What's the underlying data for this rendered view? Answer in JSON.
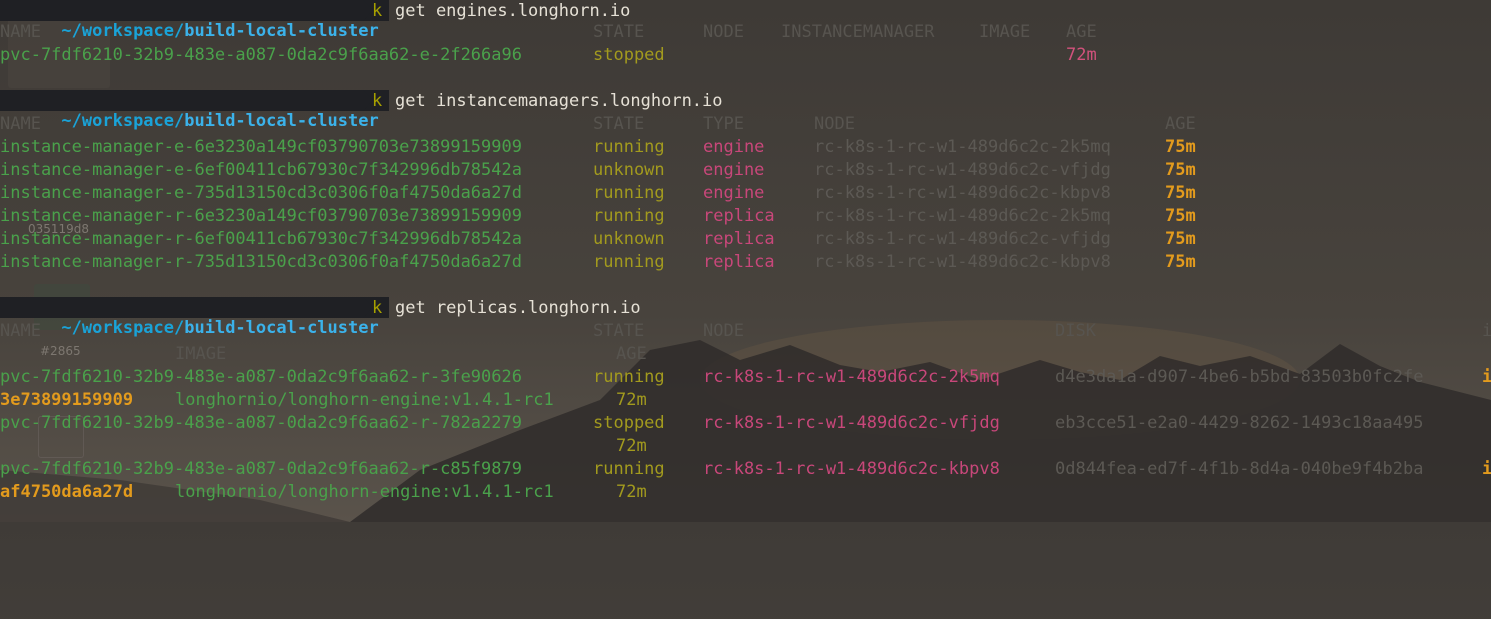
{
  "prompt": {
    "path_prefix": "~/workspace/",
    "path_dir": "build-local-cluster",
    "alias": "k"
  },
  "blocks": [
    {
      "command": "get engines.longhorn.io",
      "headers": [
        "NAME",
        "STATE",
        "NODE",
        "INSTANCEMANAGER",
        "IMAGE",
        "AGE"
      ],
      "rows": [
        {
          "name": "pvc-7fdf6210-32b9-483e-a087-0da2c9f6aa62-e-2f266a96",
          "state": "stopped",
          "age": "72m"
        }
      ]
    },
    {
      "command": "get instancemanagers.longhorn.io",
      "headers": [
        "NAME",
        "STATE",
        "TYPE",
        "NODE",
        "AGE"
      ],
      "rows": [
        {
          "name": "instance-manager-e-6e3230a149cf03790703e73899159909",
          "state": "running",
          "type": "engine",
          "node": "rc-k8s-1-rc-w1-489d6c2c-2k5mq",
          "age": "75m"
        },
        {
          "name": "instance-manager-e-6ef00411cb67930c7f342996db78542a",
          "state": "unknown",
          "type": "engine",
          "node": "rc-k8s-1-rc-w1-489d6c2c-vfjdg",
          "age": "75m"
        },
        {
          "name": "instance-manager-e-735d13150cd3c0306f0af4750da6a27d",
          "state": "running",
          "type": "engine",
          "node": "rc-k8s-1-rc-w1-489d6c2c-kbpv8",
          "age": "75m"
        },
        {
          "name": "instance-manager-r-6e3230a149cf03790703e73899159909",
          "state": "running",
          "type": "replica",
          "node": "rc-k8s-1-rc-w1-489d6c2c-2k5mq",
          "age": "75m"
        },
        {
          "name": "instance-manager-r-6ef00411cb67930c7f342996db78542a",
          "state": "unknown",
          "type": "replica",
          "node": "rc-k8s-1-rc-w1-489d6c2c-vfjdg",
          "age": "75m"
        },
        {
          "name": "instance-manager-r-735d13150cd3c0306f0af4750da6a27d",
          "state": "running",
          "type": "replica",
          "node": "rc-k8s-1-rc-w1-489d6c2c-kbpv8",
          "age": "75m"
        }
      ]
    },
    {
      "command": "get replicas.longhorn.io",
      "headers": [
        "NAME",
        "STATE",
        "NODE",
        "DISK",
        "i"
      ],
      "headers_wrap": [
        "IMAGE",
        "AGE"
      ],
      "rows": [
        {
          "name": "pvc-7fdf6210-32b9-483e-a087-0da2c9f6aa62-r-3fe90626",
          "state": "running",
          "node": "rc-k8s-1-rc-w1-489d6c2c-2k5mq",
          "disk": "d4e3da1a-d907-4be6-b5bd-83503b0fc2fe",
          "trail": "i",
          "wrap_im": "3e73899159909",
          "wrap_image": "longhornio/longhorn-engine:v1.4.1-rc1",
          "age": "72m"
        },
        {
          "name": "pvc-7fdf6210-32b9-483e-a087-0da2c9f6aa62-r-782a2279",
          "state": "stopped",
          "node": "rc-k8s-1-rc-w1-489d6c2c-vfjdg",
          "disk": "eb3cce51-e2a0-4429-8262-1493c18aa495",
          "trail": "",
          "wrap_im": "",
          "wrap_image": "",
          "age": "72m"
        },
        {
          "name": "pvc-7fdf6210-32b9-483e-a087-0da2c9f6aa62-r-c85f9879",
          "state": "running",
          "node": "rc-k8s-1-rc-w1-489d6c2c-kbpv8",
          "disk": "0d844fea-ed7f-4f1b-8d4a-040be9f4b2ba",
          "trail": "i",
          "wrap_im": "af4750da6a27d",
          "wrap_image": "longhornio/longhorn-engine:v1.4.1-rc1",
          "age": "72m"
        }
      ]
    }
  ],
  "background_labels": {
    "issue_number": "#2865",
    "fragment": "035119d8"
  },
  "colors": {
    "prompt_bg": "#1f2024",
    "path": "#1aa3d8",
    "alias": "#a6a000",
    "header": "#57544f",
    "name": "#4aa14b",
    "state": "#a29a1e",
    "type": "#c8477a",
    "node_im": "#5c5954",
    "age_im": "#e39b1d"
  }
}
